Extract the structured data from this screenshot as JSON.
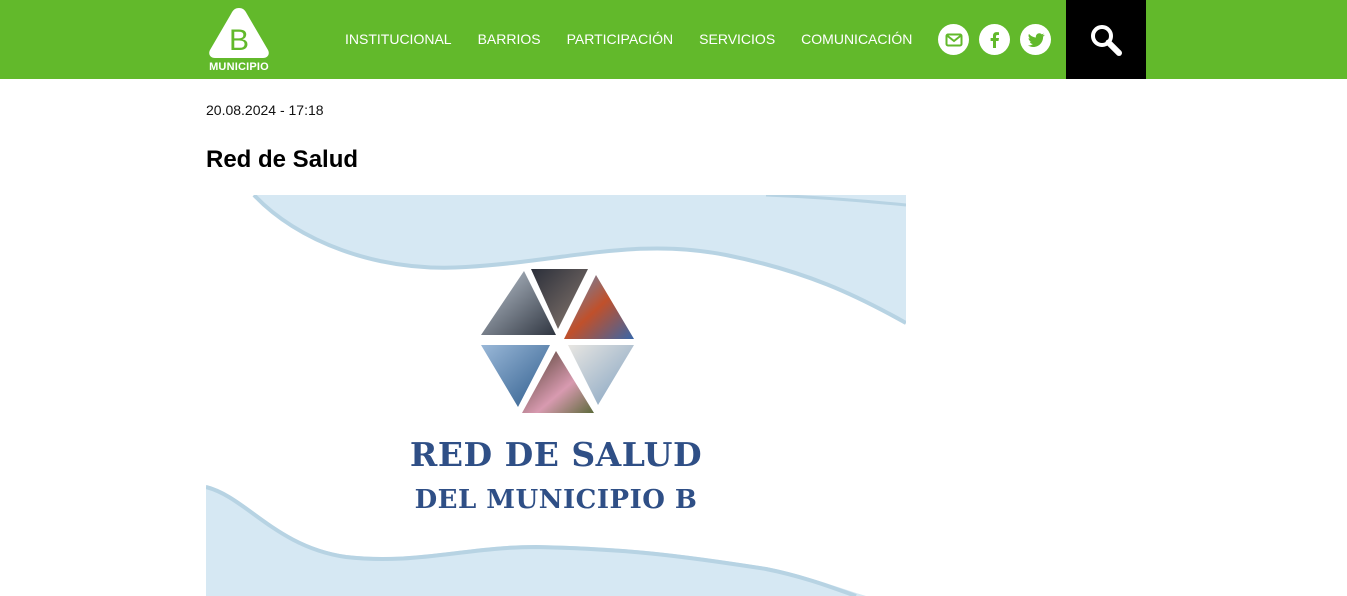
{
  "header": {
    "logo": {
      "letter": "B",
      "label": "MUNICIPIO"
    },
    "nav": [
      {
        "label": "INSTITUCIONAL"
      },
      {
        "label": "BARRIOS"
      },
      {
        "label": "PARTICIPACIÓN"
      },
      {
        "label": "SERVICIOS"
      },
      {
        "label": "COMUNICACIÓN"
      }
    ],
    "social_icons": [
      "mail-icon",
      "facebook-icon",
      "twitter-icon"
    ],
    "search_icon": "search-icon"
  },
  "article": {
    "date": "20.08.2024 - 17:18",
    "title": "Red de Salud",
    "banner": {
      "line1": "RED DE SALUD",
      "line2": "DEL MUNICIPIO B"
    }
  },
  "colors": {
    "header_green": "#62b92b",
    "search_bg": "#000000",
    "banner_wave": "#d6e8f3",
    "banner_text": "#2f4f86"
  }
}
